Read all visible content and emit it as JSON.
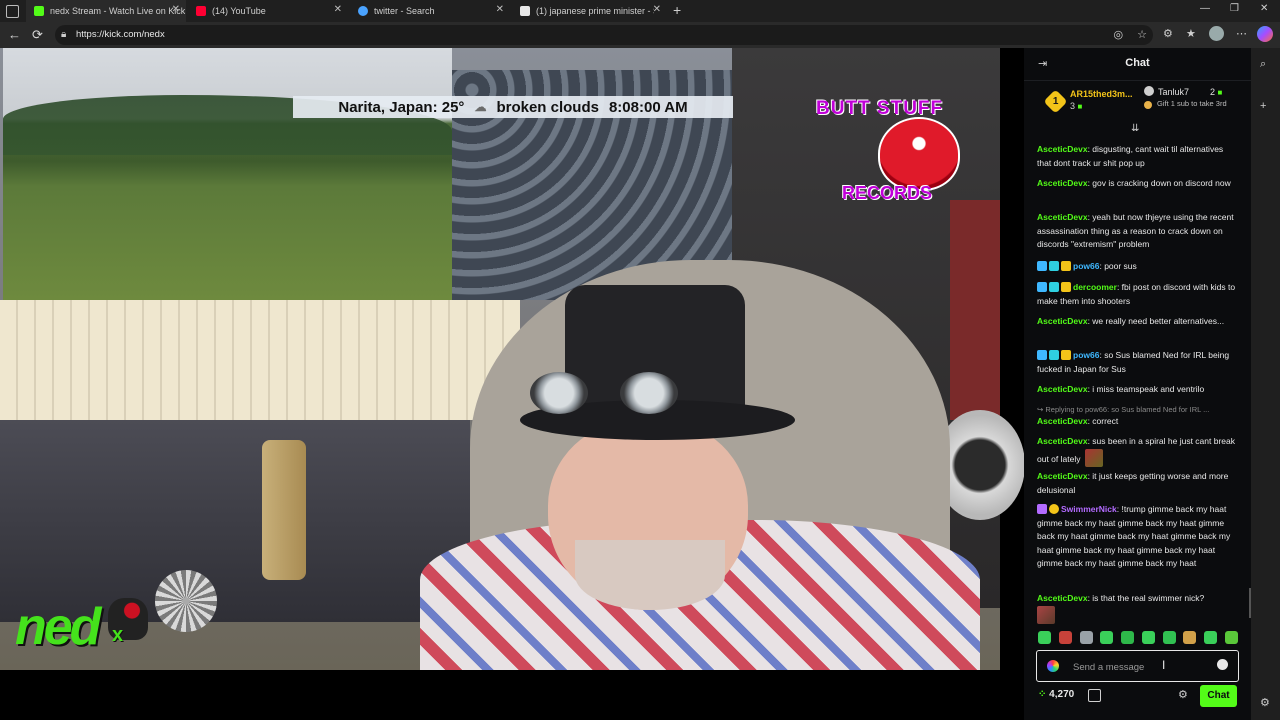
{
  "browser": {
    "tabs": [
      {
        "title": "nedx Stream - Watch Live on Kick",
        "favicon_color": "#53fc18"
      },
      {
        "title": "(14) YouTube",
        "favicon_color": "#ff0033"
      },
      {
        "title": "twitter - Search",
        "favicon_color": "#4aa3ff"
      },
      {
        "title": "(1) japanese prime minister - Search",
        "favicon_color": "#e8e8e8"
      }
    ],
    "new_tab_label": "+",
    "window_controls": [
      "—",
      "❐",
      "✕"
    ],
    "url": "https://kick.com/nedx"
  },
  "stream": {
    "weather_text": "Narita, Japan: 25°",
    "weather_icon": "cloud-icon",
    "weather_condition": "broken clouds",
    "weather_time": "8:08:00 AM",
    "banner_top": "BUTT STUFF",
    "banner_bottom": "RECORDS",
    "logo_text": "ned",
    "logo_suffix": "x",
    "colors": {
      "logo_green": "#45e21c",
      "banner_purple": "#c000d8"
    }
  },
  "chat": {
    "title": "Chat",
    "leaderboard": [
      {
        "rank": "1",
        "name": "AR15thed3m...",
        "count": "3"
      },
      {
        "name": "Tanluk7",
        "count": "2",
        "note": "Gift 1 sub to take 3rd"
      }
    ],
    "messages": [
      {
        "user": "AsceticDevx",
        "color": "#53fc18",
        "text": "disgusting, cant wait til alternatives that dont track ur shit pop up"
      },
      {
        "user": "AsceticDevx",
        "color": "#53fc18",
        "text": "gov is cracking down on discord now"
      },
      {
        "user": "AsceticDevx",
        "color": "#53fc18",
        "text": "yeah but now thjeyre using the recent assassination thing as a reason to crack down on discords \"extremism\" problem"
      },
      {
        "user": "pow66",
        "color": "#3fb8ff",
        "text": "poor sus",
        "badges": true
      },
      {
        "user": "dercoomer",
        "color": "#53fc18",
        "text": "fbi post on discord with kids to make them into shooters",
        "badges": true
      },
      {
        "user": "AsceticDevx",
        "color": "#53fc18",
        "text": "we really need better alternatives..."
      },
      {
        "user": "pow66",
        "color": "#3fb8ff",
        "text": "so Sus blamed Ned for IRL being fucked in Japan for Sus",
        "badges": true
      },
      {
        "user": "AsceticDevx",
        "color": "#53fc18",
        "text": "i miss teamspeak and ventrilo"
      },
      {
        "reply": "↪ Replying to pow66: so Sus blamed Ned for IRL ..."
      },
      {
        "user": "AsceticDevx",
        "color": "#53fc18",
        "text": "correct"
      },
      {
        "user": "AsceticDevx",
        "color": "#53fc18",
        "text": "sus been in a spiral he just cant break out of lately"
      },
      {
        "user": "AsceticDevx",
        "color": "#53fc18",
        "text": "it just keeps getting worse and more delusional"
      },
      {
        "user": "SwimmerNick",
        "color": "#b36bff",
        "text": "!trump gimme back my haat gimme back my haat gimme back my haat gimme back my haat gimme back my haat gimme back my haat gimme back my haat gimme back my haat gimme back my haat gimme back my haat",
        "badges": true
      },
      {
        "user": "AsceticDevx",
        "color": "#53fc18",
        "text": "is that the real swimmer nick?"
      }
    ],
    "input_placeholder": "Send a message",
    "kicks_count": "4,270",
    "send_label": "Chat",
    "accent": "#53fc18"
  }
}
